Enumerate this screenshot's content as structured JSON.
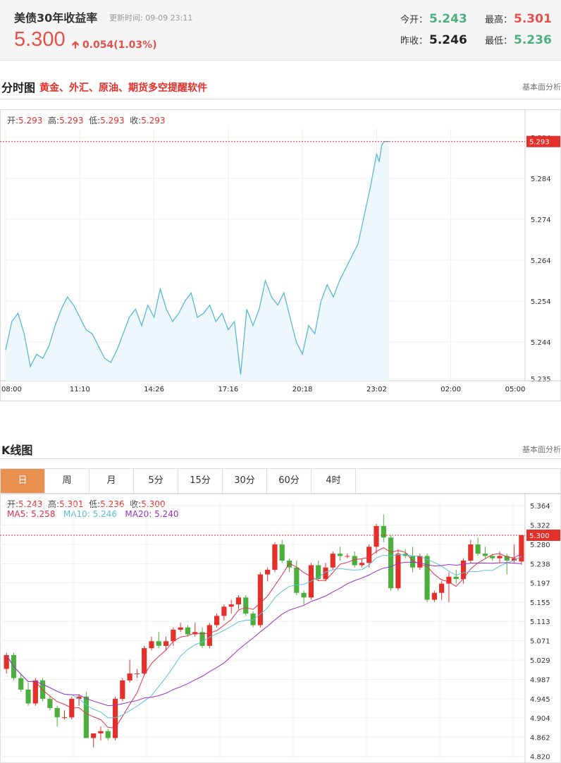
{
  "quote": {
    "title": "美债30年收益率",
    "time_label": "更新时间:",
    "time": "09-09 23:11",
    "price": "5.300",
    "change": "0.054(1.03%)",
    "open_label": "今开：",
    "open": "5.243",
    "prev_label": "昨收：",
    "prev": "5.246",
    "high_label": "最高：",
    "high": "5.301",
    "low_label": "最低：",
    "low": "5.236"
  },
  "intraday_section": {
    "title": "分时图",
    "promo": "黄金、外汇、原油、期货多空提醒软件",
    "right_label": "基本面分析",
    "ohlc": {
      "open_label": "开:",
      "open": "5.293",
      "high_label": "高:",
      "high": "5.293",
      "low_label": "低:",
      "low": "5.293",
      "close_label": "收:",
      "close": "5.293"
    }
  },
  "kline_section": {
    "title": "K线图",
    "right_label": "基本面分析",
    "tabs": [
      "日",
      "周",
      "月",
      "5分",
      "15分",
      "30分",
      "60分",
      "4时"
    ],
    "active_tab": 0,
    "ohlc": {
      "open_label": "开:",
      "open": "5.243",
      "high_label": "高:",
      "high": "5.301",
      "low_label": "低:",
      "low": "5.236",
      "close_label": "收:",
      "close": "5.300"
    },
    "ma": {
      "ma5_label": "MA5:",
      "ma5": "5.258",
      "ma10_label": "MA10:",
      "ma10": "5.246",
      "ma20_label": "MA20:",
      "ma20": "5.240"
    }
  },
  "colors": {
    "up": "#e4302a",
    "down": "#4caf3d",
    "line": "#5bb8d4",
    "fill": "#eef7fb",
    "ma5": "#e4304a",
    "ma10": "#5bc0de",
    "ma20": "#9b30c8",
    "accent": "#e8904f"
  },
  "chart_data": [
    {
      "type": "line",
      "x_ticks": [
        "08:00",
        "11:10",
        "14:26",
        "17:16",
        "20:18",
        "23:02",
        "02:00",
        "05:00"
      ],
      "y_ticks": [
        "5.235",
        "5.244",
        "5.254",
        "5.264",
        "5.274",
        "5.284",
        "5.294"
      ],
      "ylim": [
        5.2345,
        5.2945
      ],
      "last_label": "5.293",
      "x_hours": [
        0,
        0.25,
        0.5,
        0.75,
        1,
        1.25,
        1.5,
        1.75,
        2,
        2.25,
        2.5,
        2.75,
        3,
        3.25,
        3.5,
        3.75,
        4,
        4.25,
        4.5,
        4.75,
        5,
        5.25,
        5.5,
        5.75,
        6,
        6.25,
        6.5,
        6.75,
        7,
        7.25,
        7.5,
        7.75,
        8,
        8.25,
        8.5,
        8.75,
        9,
        9.25,
        9.5,
        9.75,
        10,
        10.25,
        10.5,
        10.75,
        11,
        11.25,
        11.5,
        11.75,
        12,
        12.25,
        12.5,
        12.75,
        13,
        13.25,
        13.5,
        13.75,
        14,
        14.25,
        14.5,
        14.75,
        15,
        15.1,
        15.2,
        15.3,
        15.4,
        15.5
      ],
      "values": [
        5.242,
        5.249,
        5.251,
        5.246,
        5.238,
        5.241,
        5.24,
        5.243,
        5.248,
        5.252,
        5.255,
        5.253,
        5.25,
        5.247,
        5.246,
        5.243,
        5.24,
        5.239,
        5.242,
        5.246,
        5.25,
        5.252,
        5.248,
        5.253,
        5.25,
        5.257,
        5.252,
        5.249,
        5.251,
        5.254,
        5.256,
        5.25,
        5.251,
        5.253,
        5.249,
        5.251,
        5.247,
        5.249,
        5.236,
        5.252,
        5.248,
        5.252,
        5.259,
        5.255,
        5.253,
        5.256,
        5.25,
        5.244,
        5.241,
        5.248,
        5.246,
        5.254,
        5.258,
        5.255,
        5.259,
        5.262,
        5.265,
        5.268,
        5.275,
        5.282,
        5.29,
        5.288,
        5.292,
        5.293,
        5.293,
        5.293
      ]
    },
    {
      "type": "candlestick",
      "y_ticks": [
        "4.820",
        "4.862",
        "4.904",
        "4.945",
        "4.987",
        "5.029",
        "5.071",
        "5.113",
        "5.155",
        "5.197",
        "5.238",
        "5.280",
        "5.322",
        "5.364"
      ],
      "ylim": [
        4.815,
        5.375
      ],
      "last_label": "5.300",
      "ohlc": [
        [
          5.01,
          5.045,
          5.0,
          5.04
        ],
        [
          5.04,
          5.045,
          4.985,
          4.99
        ],
        [
          4.99,
          5.0,
          4.96,
          4.965
        ],
        [
          4.965,
          4.98,
          4.93,
          4.935
        ],
        [
          4.935,
          4.99,
          4.93,
          4.985
        ],
        [
          4.985,
          4.99,
          4.94,
          4.945
        ],
        [
          4.945,
          4.95,
          4.92,
          4.925
        ],
        [
          4.925,
          4.93,
          4.885,
          4.905
        ],
        [
          4.905,
          4.92,
          4.9,
          4.905
        ],
        [
          4.905,
          4.95,
          4.9,
          4.945
        ],
        [
          4.945,
          4.955,
          4.93,
          4.95
        ],
        [
          4.95,
          4.96,
          4.86,
          4.86
        ],
        [
          4.86,
          4.87,
          4.84,
          4.87
        ],
        [
          4.87,
          4.885,
          4.855,
          4.875
        ],
        [
          4.875,
          4.88,
          4.855,
          4.86
        ],
        [
          4.86,
          4.95,
          4.855,
          4.945
        ],
        [
          4.945,
          4.99,
          4.94,
          4.985
        ],
        [
          4.985,
          5.03,
          4.98,
          5.0
        ],
        [
          5.0,
          5.01,
          4.99,
          5.0
        ],
        [
          5.0,
          5.06,
          4.995,
          5.055
        ],
        [
          5.055,
          5.08,
          5.05,
          5.07
        ],
        [
          5.07,
          5.09,
          5.055,
          5.06
        ],
        [
          5.06,
          5.08,
          5.05,
          5.07
        ],
        [
          5.07,
          5.1,
          5.06,
          5.095
        ],
        [
          5.095,
          5.11,
          5.09,
          5.1
        ],
        [
          5.1,
          5.105,
          5.08,
          5.085
        ],
        [
          5.085,
          5.11,
          5.08,
          5.09
        ],
        [
          5.09,
          5.1,
          5.055,
          5.06
        ],
        [
          5.06,
          5.11,
          5.055,
          5.105
        ],
        [
          5.105,
          5.13,
          5.1,
          5.125
        ],
        [
          5.125,
          5.15,
          5.115,
          5.145
        ],
        [
          5.145,
          5.16,
          5.13,
          5.15
        ],
        [
          5.15,
          5.17,
          5.14,
          5.165
        ],
        [
          5.165,
          5.17,
          5.125,
          5.13
        ],
        [
          5.13,
          5.135,
          5.1,
          5.105
        ],
        [
          5.105,
          5.22,
          5.1,
          5.215
        ],
        [
          5.215,
          5.23,
          5.2,
          5.225
        ],
        [
          5.225,
          5.285,
          5.22,
          5.28
        ],
        [
          5.28,
          5.29,
          5.24,
          5.245
        ],
        [
          5.245,
          5.25,
          5.22,
          5.23
        ],
        [
          5.23,
          5.245,
          5.17,
          5.175
        ],
        [
          5.175,
          5.18,
          5.15,
          5.165
        ],
        [
          5.165,
          5.24,
          5.16,
          5.235
        ],
        [
          5.235,
          5.245,
          5.2,
          5.205
        ],
        [
          5.205,
          5.24,
          5.2,
          5.23
        ],
        [
          5.23,
          5.265,
          5.225,
          5.26
        ],
        [
          5.26,
          5.275,
          5.245,
          5.255
        ],
        [
          5.255,
          5.26,
          5.25,
          5.255
        ],
        [
          5.255,
          5.265,
          5.23,
          5.235
        ],
        [
          5.235,
          5.25,
          5.23,
          5.24
        ],
        [
          5.24,
          5.28,
          5.23,
          5.275
        ],
        [
          5.275,
          5.325,
          5.26,
          5.32
        ],
        [
          5.32,
          5.345,
          5.285,
          5.295
        ],
        [
          5.295,
          5.3,
          5.18,
          5.185
        ],
        [
          5.185,
          5.27,
          5.18,
          5.26
        ],
        [
          5.26,
          5.27,
          5.25,
          5.255
        ],
        [
          5.255,
          5.275,
          5.22,
          5.23
        ],
        [
          5.23,
          5.26,
          5.225,
          5.255
        ],
        [
          5.255,
          5.26,
          5.155,
          5.16
        ],
        [
          5.16,
          5.18,
          5.155,
          5.175
        ],
        [
          5.175,
          5.2,
          5.16,
          5.195
        ],
        [
          5.195,
          5.22,
          5.155,
          5.21
        ],
        [
          5.21,
          5.225,
          5.195,
          5.205
        ],
        [
          5.205,
          5.25,
          5.195,
          5.245
        ],
        [
          5.245,
          5.29,
          5.24,
          5.28
        ],
        [
          5.28,
          5.295,
          5.255,
          5.26
        ],
        [
          5.26,
          5.275,
          5.25,
          5.255
        ],
        [
          5.255,
          5.26,
          5.245,
          5.25
        ],
        [
          5.25,
          5.265,
          5.24,
          5.255
        ],
        [
          5.255,
          5.26,
          5.215,
          5.245
        ],
        [
          5.245,
          5.28,
          5.24,
          5.25
        ],
        [
          5.243,
          5.301,
          5.236,
          5.3
        ]
      ]
    }
  ]
}
